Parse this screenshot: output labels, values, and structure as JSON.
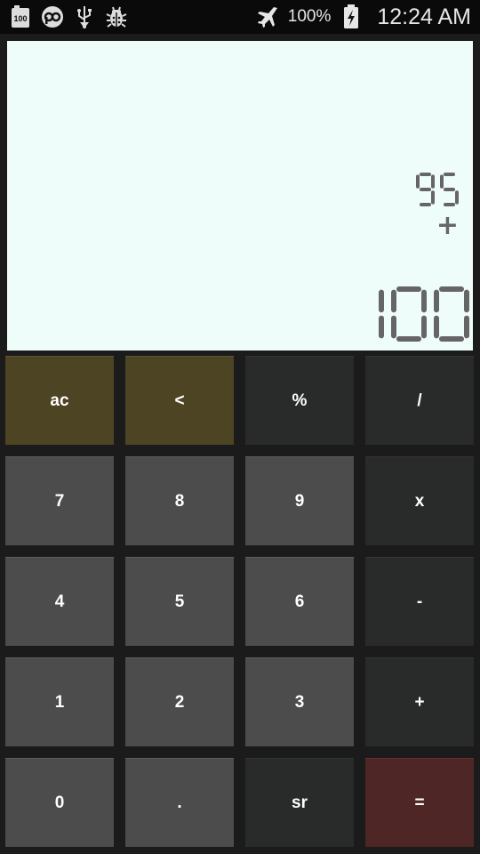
{
  "status_bar": {
    "left_icons": [
      "battery-100-icon",
      "pa-logo-icon",
      "usb-icon",
      "bug-icon"
    ],
    "airplane_icon": "airplane-icon",
    "battery_percent": "100%",
    "battery_icon": "battery-charging-icon",
    "time": "12:24 AM"
  },
  "display": {
    "previous_number": "95",
    "operator": "+",
    "current_number": "100",
    "background_color": "#eefdf9",
    "digit_color": "#656565"
  },
  "keypad": {
    "rows": [
      [
        {
          "label": "ac",
          "kind": "fn"
        },
        {
          "label": "<",
          "kind": "fn"
        },
        {
          "label": "%",
          "kind": "op"
        },
        {
          "label": "/",
          "kind": "op"
        }
      ],
      [
        {
          "label": "7",
          "kind": "num"
        },
        {
          "label": "8",
          "kind": "num"
        },
        {
          "label": "9",
          "kind": "num"
        },
        {
          "label": "x",
          "kind": "op"
        }
      ],
      [
        {
          "label": "4",
          "kind": "num"
        },
        {
          "label": "5",
          "kind": "num"
        },
        {
          "label": "6",
          "kind": "num"
        },
        {
          "label": "-",
          "kind": "op"
        }
      ],
      [
        {
          "label": "1",
          "kind": "num"
        },
        {
          "label": "2",
          "kind": "num"
        },
        {
          "label": "3",
          "kind": "num"
        },
        {
          "label": "+",
          "kind": "op"
        }
      ],
      [
        {
          "label": "0",
          "kind": "num"
        },
        {
          "label": ".",
          "kind": "num"
        },
        {
          "label": "sr",
          "kind": "op"
        },
        {
          "label": "=",
          "kind": "eq"
        }
      ]
    ]
  }
}
